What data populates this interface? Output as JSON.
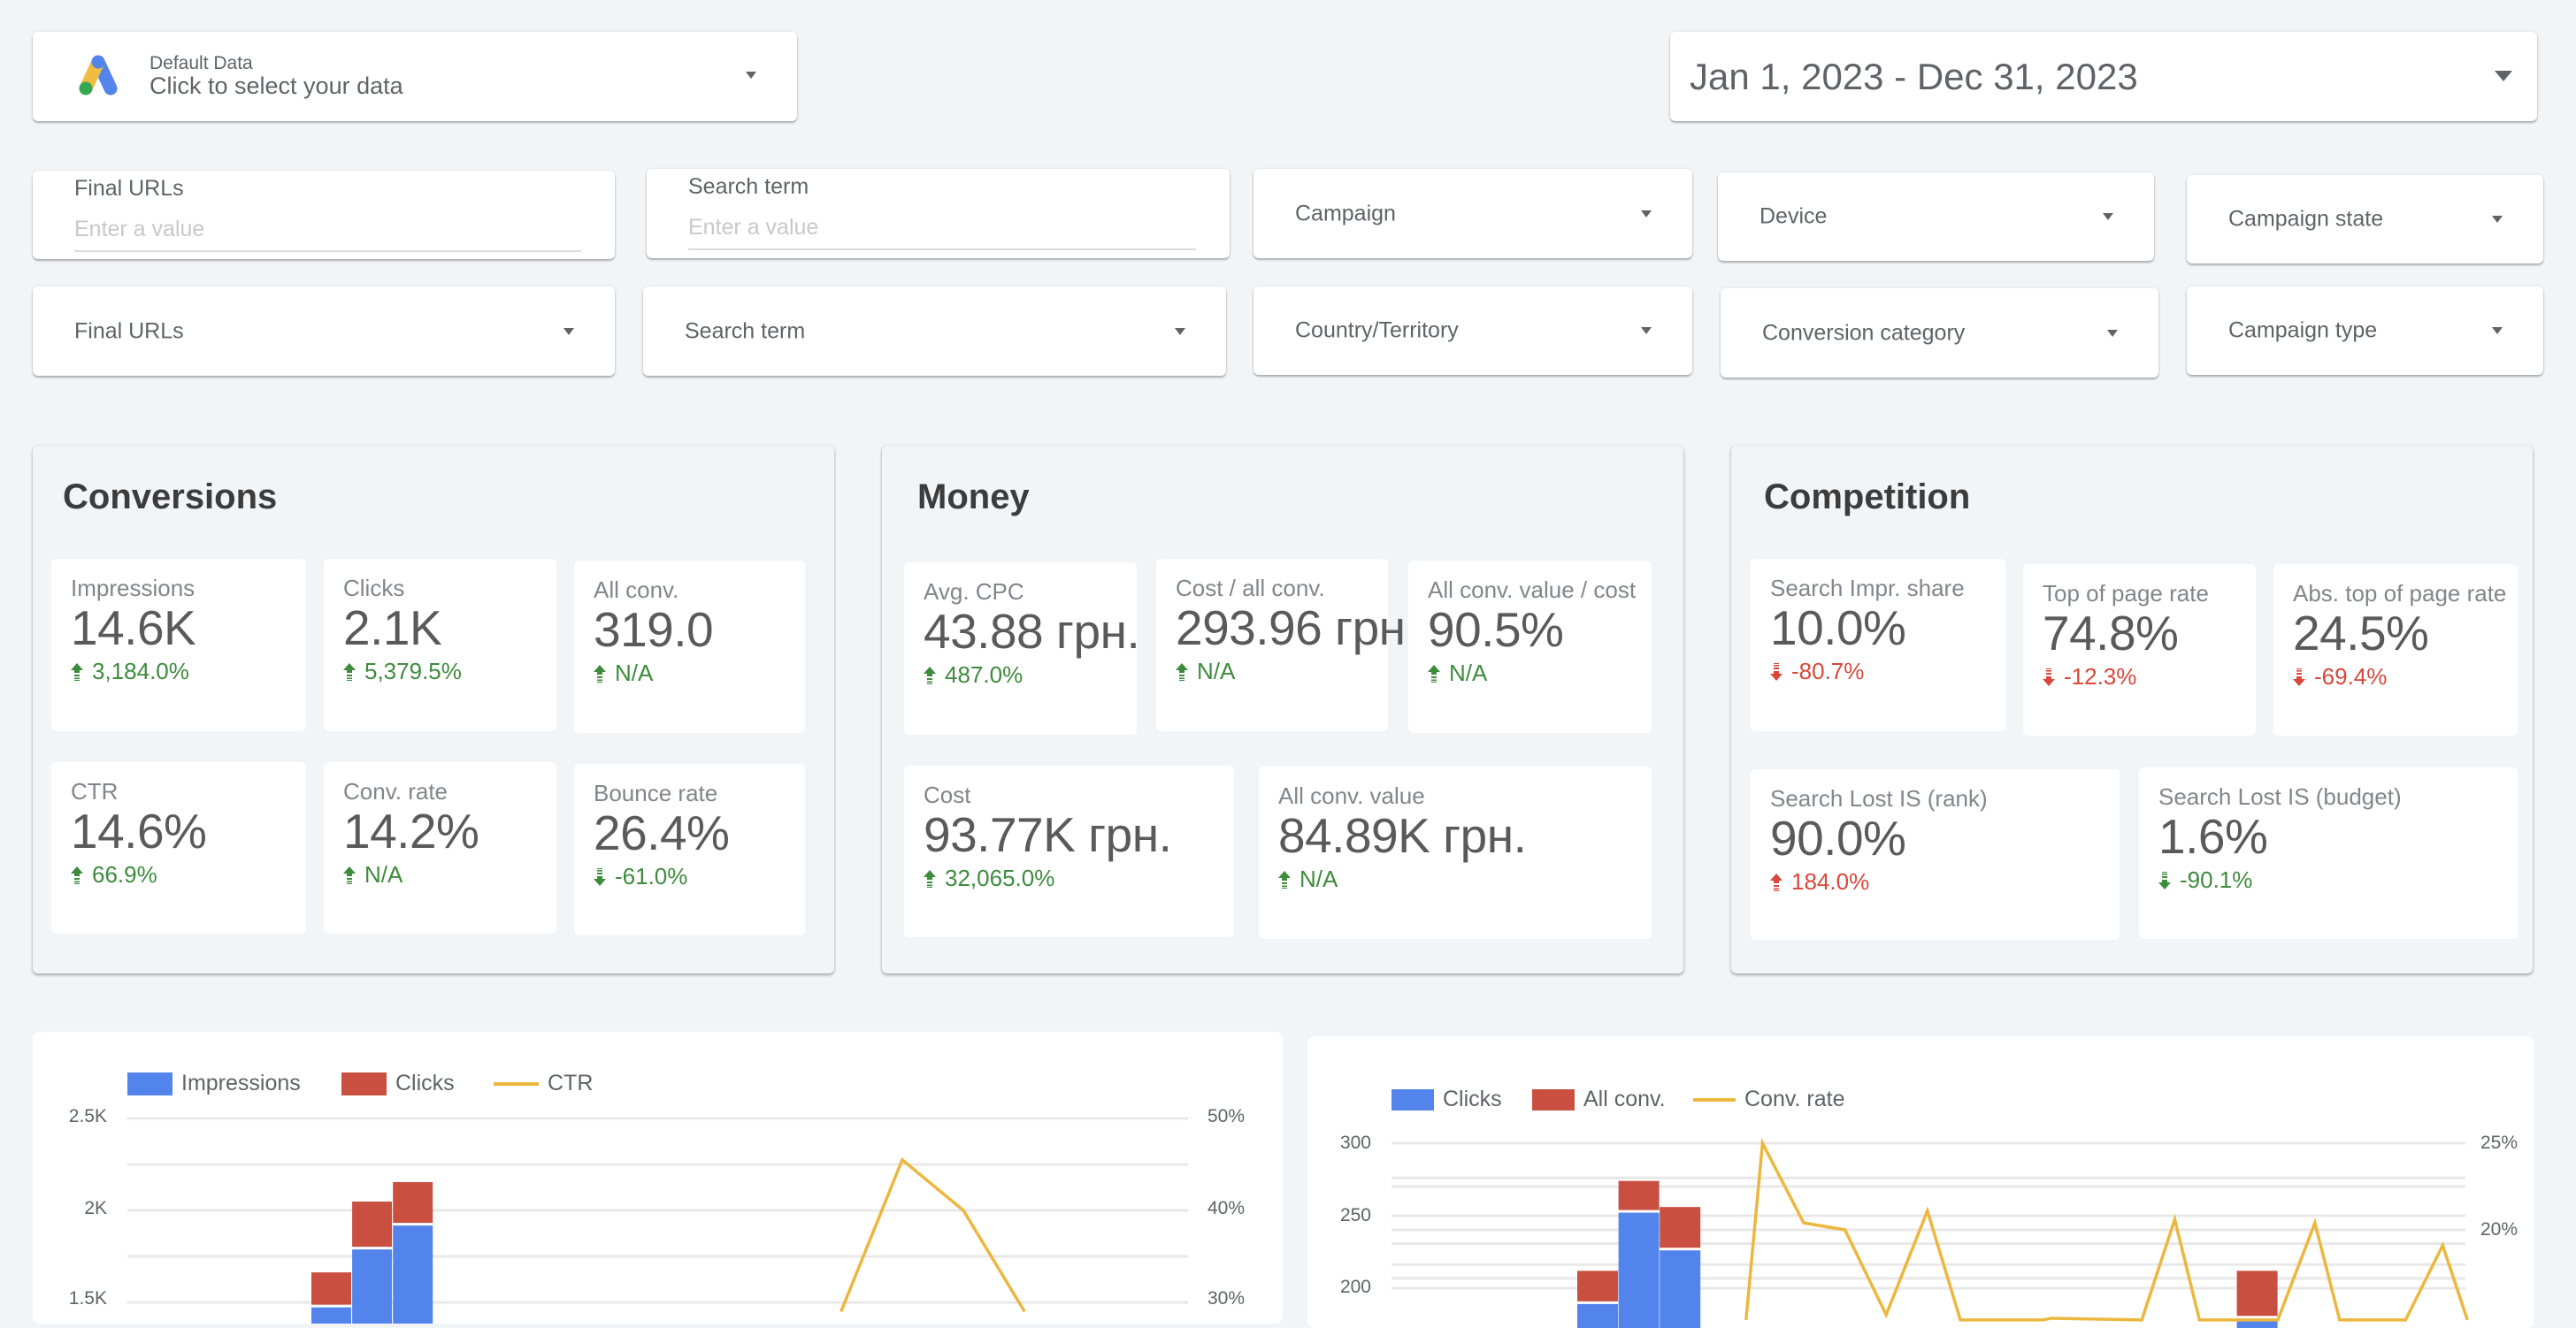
{
  "data_source": {
    "icon": "google-ads-logo",
    "title": "Default Data",
    "subtitle": "Click to select your data"
  },
  "date_range": {
    "label": "Jan 1, 2023 - Dec 31, 2023"
  },
  "filters": {
    "final_urls_input": {
      "label": "Final URLs",
      "placeholder": "Enter a value",
      "value": ""
    },
    "search_term_input": {
      "label": "Search term",
      "placeholder": "Enter a value",
      "value": ""
    },
    "campaign": {
      "label": "Campaign"
    },
    "device": {
      "label": "Device"
    },
    "campaign_state": {
      "label": "Campaign state"
    },
    "final_urls_dropdown": {
      "label": "Final URLs"
    },
    "search_term_dropdown": {
      "label": "Search term"
    },
    "country": {
      "label": "Country/Territory"
    },
    "conversion_category": {
      "label": "Conversion category"
    },
    "campaign_type": {
      "label": "Campaign type"
    }
  },
  "panels": {
    "conversions": {
      "title": "Conversions",
      "cards": [
        {
          "label": "Impressions",
          "value": "14.6K",
          "delta": "3,184.0%",
          "direction": "up",
          "sentiment": "positive"
        },
        {
          "label": "Clicks",
          "value": "2.1K",
          "delta": "5,379.5%",
          "direction": "up",
          "sentiment": "positive"
        },
        {
          "label": "All conv.",
          "value": "319.0",
          "delta": "N/A",
          "direction": "up",
          "sentiment": "positive"
        },
        {
          "label": "CTR",
          "value": "14.6%",
          "delta": "66.9%",
          "direction": "up",
          "sentiment": "positive"
        },
        {
          "label": "Conv. rate",
          "value": "14.2%",
          "delta": "N/A",
          "direction": "up",
          "sentiment": "positive"
        },
        {
          "label": "Bounce rate",
          "value": "26.4%",
          "delta": "-61.0%",
          "direction": "down",
          "sentiment": "positive"
        }
      ]
    },
    "money": {
      "title": "Money",
      "cards": [
        {
          "label": "Avg. CPC",
          "value": "43.88 грн.",
          "delta": "487.0%",
          "direction": "up",
          "sentiment": "positive"
        },
        {
          "label": "Cost / all conv.",
          "value": "293.96 грн",
          "delta": "N/A",
          "direction": "up",
          "sentiment": "positive"
        },
        {
          "label": "All conv. value / cost",
          "value": "90.5%",
          "delta": "N/A",
          "direction": "up",
          "sentiment": "positive"
        },
        {
          "label": "Cost",
          "value": "93.77K грн.",
          "delta": "32,065.0%",
          "direction": "up",
          "sentiment": "positive"
        },
        {
          "label": "All conv. value",
          "value": "84.89K грн.",
          "delta": "N/A",
          "direction": "up",
          "sentiment": "positive"
        }
      ]
    },
    "competition": {
      "title": "Competition",
      "cards": [
        {
          "label": "Search Impr. share",
          "value": "10.0%",
          "delta": "-80.7%",
          "direction": "down",
          "sentiment": "negative"
        },
        {
          "label": "Top of page rate",
          "value": "74.8%",
          "delta": "-12.3%",
          "direction": "down",
          "sentiment": "negative"
        },
        {
          "label": "Abs. top of page rate",
          "value": "24.5%",
          "delta": "-69.4%",
          "direction": "down",
          "sentiment": "negative"
        },
        {
          "label": "Search Lost IS (rank)",
          "value": "90.0%",
          "delta": "184.0%",
          "direction": "up",
          "sentiment": "negative"
        },
        {
          "label": "Search Lost IS (budget)",
          "value": "1.6%",
          "delta": "-90.1%",
          "direction": "down",
          "sentiment": "positive"
        }
      ]
    }
  },
  "colors": {
    "positive": "#3d8b3d",
    "negative": "#d9473a",
    "series_blue": "#5384ec",
    "series_red": "#c95041",
    "series_yellow": "#ecb73e",
    "grid": "#e8e8e8"
  },
  "chart_data": [
    {
      "type": "bar",
      "stacked": true,
      "partially_visible": true,
      "legend": [
        "Impressions",
        "Clicks",
        "CTR"
      ],
      "legend_position": "top-left",
      "y_left": {
        "ticks": [
          "2.5K",
          "2K",
          "1.5K"
        ],
        "visible_range": [
          1450,
          2500
        ],
        "tick_values": [
          2500,
          2000,
          1500
        ]
      },
      "y_right": {
        "ticks": [
          "50%",
          "40%",
          "30%"
        ],
        "visible_range": [
          29,
          50
        ],
        "tick_values": [
          50,
          40,
          30
        ]
      },
      "grid": true,
      "bars": [
        {
          "slot": 5,
          "impressions_top": 1480,
          "total": 1663
        },
        {
          "slot": 6,
          "impressions_top": 1795,
          "total": 2048
        },
        {
          "slot": 7,
          "impressions_top": 1925,
          "total": 2154
        }
      ],
      "series": [
        {
          "name": "CTR",
          "type": "line",
          "axis": "right",
          "points": [
            {
              "slot": 17.5,
              "value": 29
            },
            {
              "slot": 19,
              "value": 45.5
            },
            {
              "slot": 20.5,
              "value": 40
            },
            {
              "slot": 22,
              "value": 29
            }
          ]
        }
      ],
      "slots": 26
    },
    {
      "type": "bar",
      "stacked": true,
      "partially_visible": true,
      "legend": [
        "Clicks",
        "All conv.",
        "Conv. rate"
      ],
      "legend_position": "top-left",
      "y_left": {
        "ticks": [
          "300",
          "250",
          "200"
        ],
        "visible_range": [
          185,
          300
        ],
        "tick_values": [
          300,
          250,
          200
        ]
      },
      "y_right": {
        "ticks": [
          "25%",
          "20%"
        ],
        "visible_range": [
          14.8,
          25
        ],
        "tick_values": [
          25,
          20
        ]
      },
      "grid": true,
      "bars": [
        {
          "slot": 5,
          "clicks_top": 190,
          "total": 212
        },
        {
          "slot": 6,
          "clicks_top": 253,
          "total": 274
        },
        {
          "slot": 7,
          "clicks_top": 227,
          "total": 256
        },
        {
          "slot": 21,
          "clicks_top": 180,
          "total": 212
        }
      ],
      "series": [
        {
          "name": "Conv. rate",
          "type": "line",
          "axis": "right",
          "points": [
            {
              "slot": 8.6,
              "value": 14.8
            },
            {
              "slot": 9,
              "value": 25
            },
            {
              "slot": 10,
              "value": 20.4
            },
            {
              "slot": 11,
              "value": 20.0
            },
            {
              "slot": 12,
              "value": 15.1
            },
            {
              "slot": 13,
              "value": 21.1
            },
            {
              "slot": 13.8,
              "value": 14.8
            },
            {
              "slot": 15.8,
              "value": 14.8
            },
            {
              "slot": 16,
              "value": 14.9
            },
            {
              "slot": 18.2,
              "value": 14.8
            },
            {
              "slot": 19,
              "value": 20.6
            },
            {
              "slot": 19.6,
              "value": 14.8
            },
            {
              "slot": 21.5,
              "value": 14.8
            },
            {
              "slot": 22.4,
              "value": 20.4
            },
            {
              "slot": 23,
              "value": 14.8
            },
            {
              "slot": 24.6,
              "value": 14.8
            },
            {
              "slot": 25.5,
              "value": 19.1
            },
            {
              "slot": 26.1,
              "value": 14.8
            }
          ]
        }
      ],
      "extra_grid_right_pct": [
        23.0,
        22.5,
        19.2,
        18.0,
        17.2
      ]
    }
  ]
}
